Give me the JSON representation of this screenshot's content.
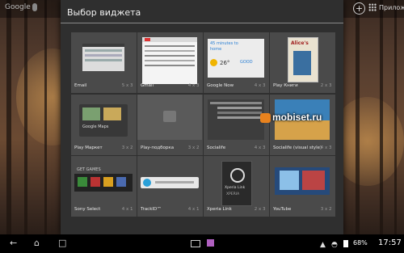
{
  "homescreen": {
    "search_label": "Google",
    "apps_label": "Прилож"
  },
  "dialog": {
    "title": "Выбор виджета"
  },
  "widgets": [
    {
      "name": "Email",
      "size": "5 x 3"
    },
    {
      "name": "Gmail",
      "size": "4 x 3"
    },
    {
      "name": "Google Now",
      "size": "4 x 3"
    },
    {
      "name": "Play Книги",
      "size": "2 x 3"
    },
    {
      "name": "Play Маркет",
      "size": "3 x 2"
    },
    {
      "name": "Play-подборка",
      "size": "3 x 2"
    },
    {
      "name": "Socialife",
      "size": "4 x 3"
    },
    {
      "name": "Socialife (visual style)",
      "size": "4 x 3"
    },
    {
      "name": "Sony Select",
      "size": "4 x 1"
    },
    {
      "name": "TrackID™",
      "size": "4 x 1"
    },
    {
      "name": "Xperia Link",
      "size": "2 x 3"
    },
    {
      "name": "YouTube",
      "size": "3 x 2"
    }
  ],
  "previews": {
    "google_now_time": "45 minutes to",
    "google_now_place": "home",
    "google_now_temp": "26°",
    "google_now_label": "GOOD",
    "google_maps_label": "Google Maps",
    "sony_select_label": "GET GAMES",
    "xperia_link_label": "Xperia Link",
    "xperia_brand": "XPERIA",
    "books_title": "Alice's"
  },
  "status_bar": {
    "battery": "68%",
    "time": "17:57"
  },
  "watermark": "mobiset.ru"
}
